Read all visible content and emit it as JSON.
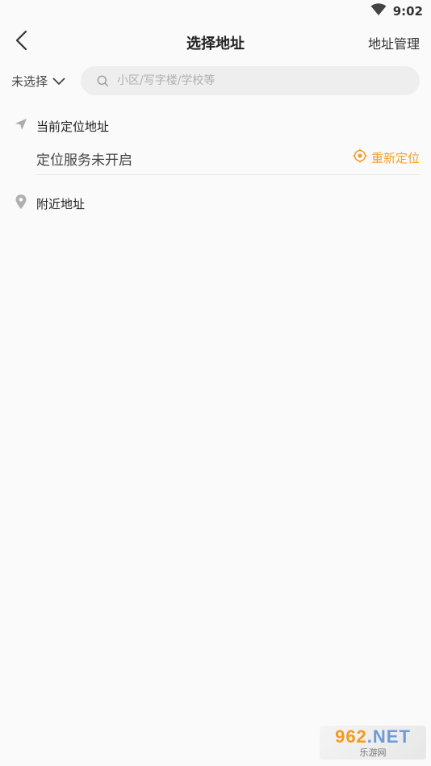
{
  "status_bar": {
    "time": "9:02",
    "wifi_icon": "wifi-icon"
  },
  "header": {
    "back_icon": "chevron-left-icon",
    "title": "选择地址",
    "manage_label": "地址管理"
  },
  "search": {
    "city_label": "未选择",
    "city_icon": "chevron-down-icon",
    "search_icon": "search-icon",
    "placeholder": "小区/写字楼/学校等",
    "value": ""
  },
  "current_location": {
    "icon": "navigation-arrow-icon",
    "heading": "当前定位地址",
    "status": "定位服务未开启",
    "relocate_icon": "target-icon",
    "relocate_label": "重新定位"
  },
  "nearby": {
    "icon": "map-pin-icon",
    "heading": "附近地址"
  },
  "watermark": {
    "logo_main": "962",
    "logo_suffix": ".NET",
    "subtitle": "乐游网"
  },
  "colors": {
    "accent": "#f0a030",
    "background": "#fafafa",
    "search_bg": "#eeeeee"
  }
}
